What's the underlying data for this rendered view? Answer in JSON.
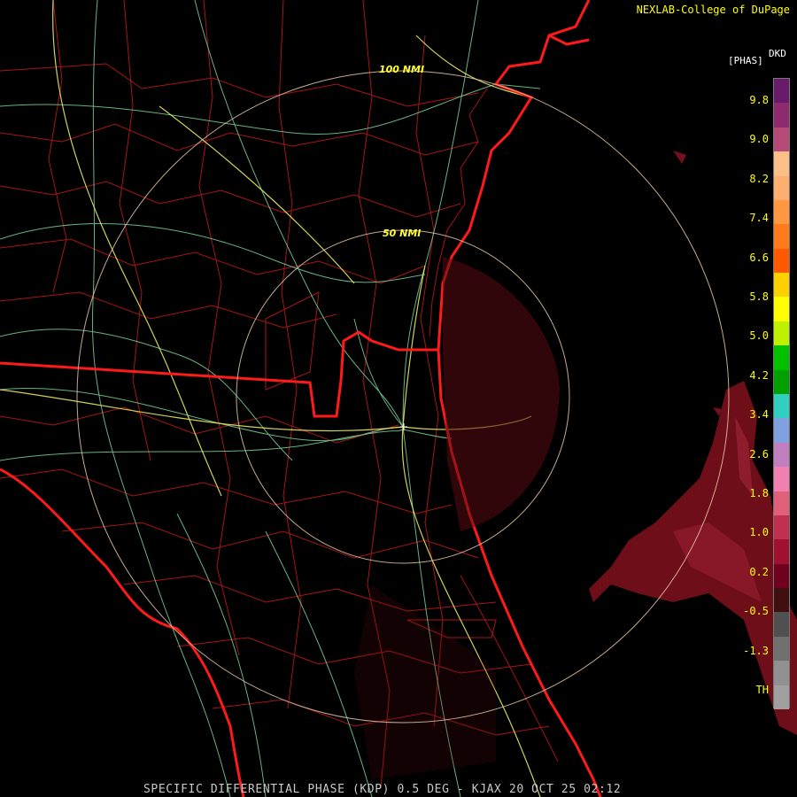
{
  "header": {
    "credit": "NEXLAB-College of DuPage",
    "product_code": "DKD",
    "product_unit": "[PHAS]"
  },
  "range_rings": [
    {
      "label": "50 NMI"
    },
    {
      "label": "100 NMI"
    }
  ],
  "legend": {
    "ticks": [
      "9.8",
      "9.0",
      "8.2",
      "7.4",
      "6.6",
      "5.8",
      "5.0",
      "4.2",
      "3.4",
      "2.6",
      "1.8",
      "1.0",
      "0.2",
      "-0.5",
      "-1.3",
      "TH"
    ],
    "colors": [
      "#6a1a6a",
      "#8e2a6e",
      "#b64a76",
      "#fbc08a",
      "#ffb070",
      "#ff9840",
      "#ff7a1a",
      "#ff5a00",
      "#ffd000",
      "#ffff00",
      "#bff000",
      "#00c000",
      "#00a000",
      "#30d0c0",
      "#80a0e0",
      "#c080c0",
      "#f080b0",
      "#e0607a",
      "#c03050",
      "#a01030",
      "#700020",
      "#401010",
      "#505050",
      "#707070",
      "#909090",
      "#a0a0a0"
    ],
    "brand_color": "#ffff00"
  },
  "footer": {
    "title": "SPECIFIC DIFFERENTIAL PHASE (KDP) 0.5 DEG - KJAX 20 OCT 25 02:12"
  }
}
